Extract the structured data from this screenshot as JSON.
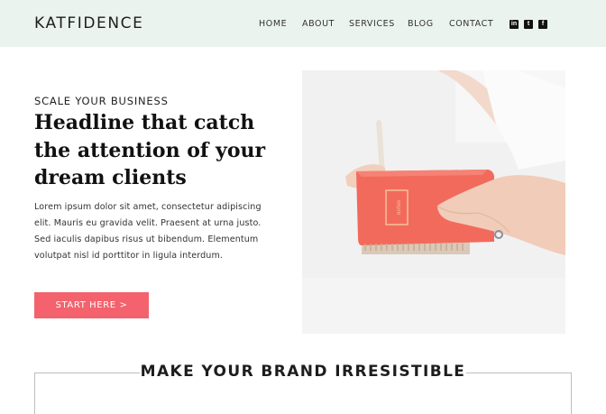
{
  "brand": {
    "logo": "KATFIDENCE"
  },
  "nav": {
    "home": "HOME",
    "about": "ABOUT",
    "services": "SERVICES",
    "blog": "BLOG",
    "contact": "CONTACT"
  },
  "social": {
    "linkedin": "in",
    "tumblr": "t",
    "facebook": "f"
  },
  "hero": {
    "eyebrow": "SCALE YOUR BUSINESS",
    "headline": "Headline that catch the attention of your dream clients",
    "body": "Lorem ipsum dolor sit amet, consectetur adipiscing elit. Mauris eu gravida velit. Praesent at urna justo. Sed iaculis dapibus risus ut bibendum. Elementum volutpat nisl id porttitor in ligula interdum.",
    "cta": "START HERE >",
    "image_notebook_text": "notes"
  },
  "section": {
    "title": "MAKE YOUR BRAND IRRESISTIBLE"
  },
  "colors": {
    "header_bg": "#ebf3ef",
    "accent": "#f3626d",
    "notebook": "#f26a5c"
  },
  "icons": [
    "linkedin-icon",
    "tumblr-icon",
    "facebook-icon"
  ]
}
